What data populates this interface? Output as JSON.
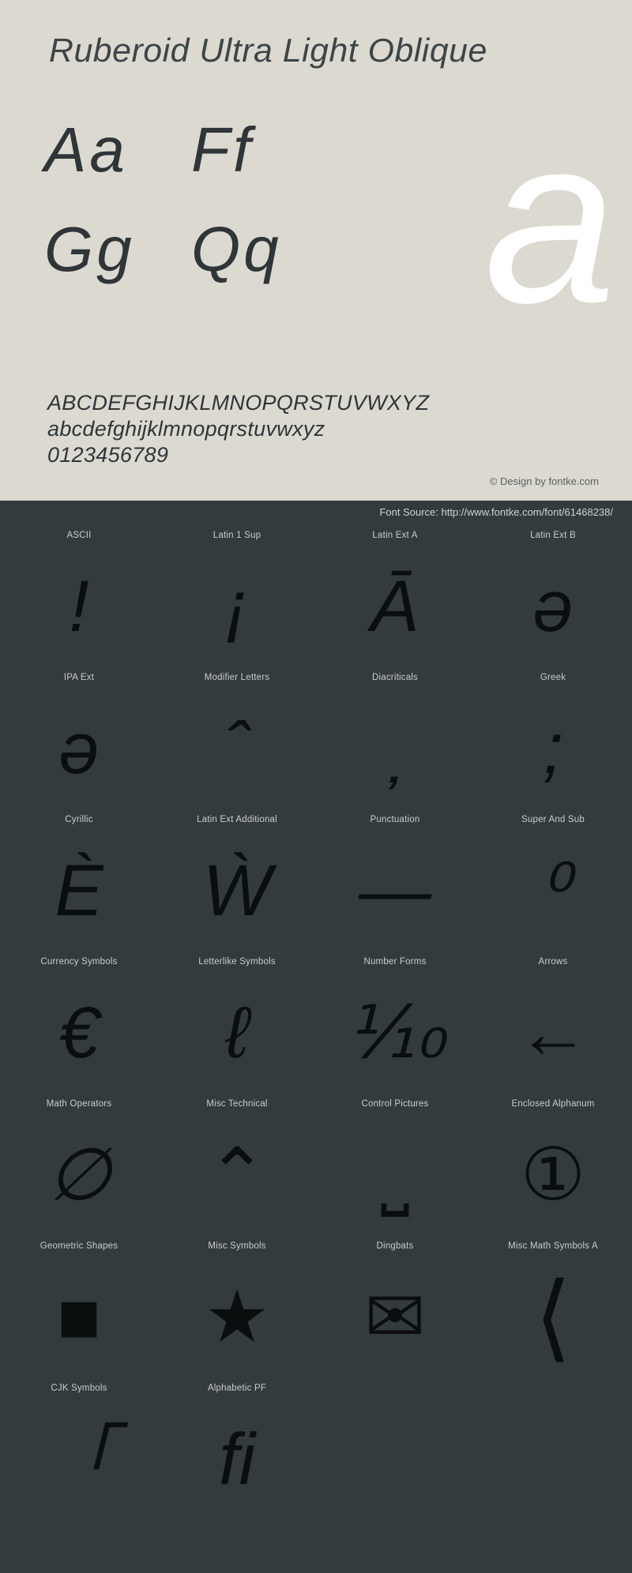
{
  "header": {
    "title": "Ruberoid Ultra Light Oblique"
  },
  "specimen": {
    "letter_pairs": [
      [
        "Aa",
        "Ff"
      ],
      [
        "Gg",
        "Qq"
      ]
    ],
    "watermark_glyph": "a",
    "alphabet_lines": [
      "ABCDEFGHIJKLMNOPQRSTUVWXYZ",
      "abcdefghijklmnopqrstuvwxyz",
      "0123456789"
    ],
    "credit": "© Design by fontke.com"
  },
  "source": {
    "label": "Font Source: http://www.fontke.com/font/61468238/"
  },
  "colors": {
    "light_bg": "#dcd9d0",
    "dark_bg": "#333b3e",
    "ink": "#2f3538",
    "label": "#c8cdcb",
    "watermark": "#ffffff"
  },
  "unicode_blocks": [
    [
      {
        "label": "ASCII",
        "glyph": "!",
        "style": "oblique"
      },
      {
        "label": "Latin 1 Sup",
        "glyph": "¡",
        "style": "oblique"
      },
      {
        "label": "Latin Ext A",
        "glyph": "Ā",
        "style": "oblique"
      },
      {
        "label": "Latin Ext B",
        "glyph": "ǝ",
        "style": "oblique"
      }
    ],
    [
      {
        "label": "IPA Ext",
        "glyph": "ə",
        "style": "oblique"
      },
      {
        "label": "Modifier Letters",
        "glyph": "ˆ",
        "style": "oblique"
      },
      {
        "label": "Diacriticals",
        "glyph": "̦",
        "style": "oblique"
      },
      {
        "label": "Greek",
        "glyph": ";",
        "style": "oblique"
      }
    ],
    [
      {
        "label": "Cyrillic",
        "glyph": "Ѐ",
        "style": "oblique"
      },
      {
        "label": "Latin Ext Additional",
        "glyph": "Ẁ",
        "style": "oblique"
      },
      {
        "label": "Punctuation",
        "glyph": "—",
        "style": "oblique"
      },
      {
        "label": "Super And Sub",
        "glyph": "⁰",
        "style": "oblique"
      }
    ],
    [
      {
        "label": "Currency Symbols",
        "glyph": "€",
        "style": "oblique"
      },
      {
        "label": "Letterlike Symbols",
        "glyph": "ℓ",
        "style": "oblique"
      },
      {
        "label": "Number Forms",
        "glyph": "⅒",
        "style": "oblique"
      },
      {
        "label": "Arrows",
        "glyph": "←",
        "style": "upright"
      }
    ],
    [
      {
        "label": "Math Operators",
        "glyph": "∅",
        "style": "oblique"
      },
      {
        "label": "Misc Technical",
        "glyph": "⌃",
        "style": "upright"
      },
      {
        "label": "Control Pictures",
        "glyph": "⎵",
        "style": "upright"
      },
      {
        "label": "Enclosed Alphanum",
        "glyph": "①",
        "style": "upright"
      }
    ],
    [
      {
        "label": "Geometric Shapes",
        "glyph": "■",
        "style": "solid"
      },
      {
        "label": "Misc Symbols",
        "glyph": "★",
        "style": "solid"
      },
      {
        "label": "Dingbats",
        "glyph": "✉",
        "style": "upright"
      },
      {
        "label": "Misc Math Symbols A",
        "glyph": "⟨",
        "style": "upright"
      }
    ],
    [
      {
        "label": "CJK Symbols",
        "glyph": "「",
        "style": "oblique"
      },
      {
        "label": "Alphabetic PF",
        "glyph": "ﬁ",
        "style": "oblique"
      },
      {
        "label": "",
        "glyph": "",
        "style": "empty"
      },
      {
        "label": "",
        "glyph": "",
        "style": "empty"
      }
    ]
  ]
}
